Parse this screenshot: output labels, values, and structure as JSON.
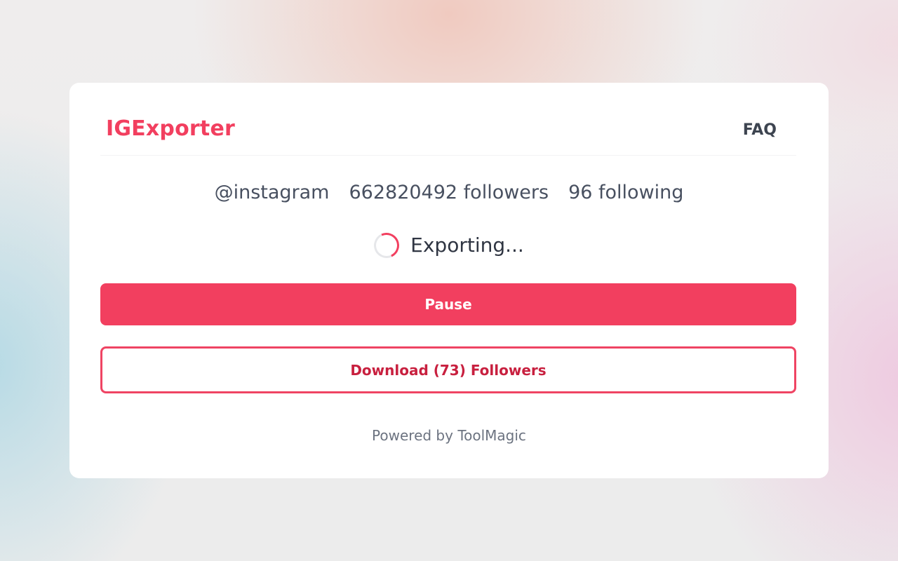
{
  "app": {
    "brand": "IGExporter",
    "nav": {
      "faq_label": "FAQ"
    }
  },
  "profile": {
    "username": "@instagram",
    "followers": "662820492 followers",
    "following": "96 following"
  },
  "status": {
    "text": "Exporting..."
  },
  "actions": {
    "pause_label": "Pause",
    "download_label": "Download (73) Followers"
  },
  "footer": {
    "text": "Powered by ToolMagic"
  },
  "colors": {
    "accent": "#f23f5f",
    "text_dark": "#2f3542",
    "card_bg": "#ffffff"
  },
  "icons": {
    "status": "loading-spinner-icon"
  }
}
